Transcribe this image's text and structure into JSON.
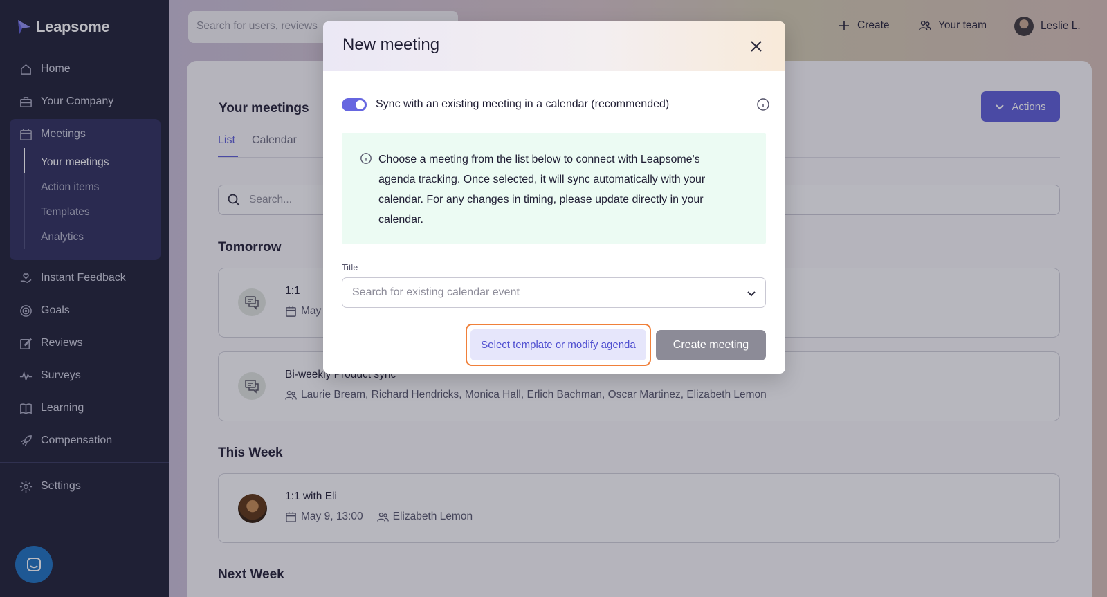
{
  "sidebar": {
    "brand": "Leapsome",
    "items": [
      {
        "label": "Home",
        "icon": "home-icon"
      },
      {
        "label": "Your Company",
        "icon": "briefcase-icon"
      },
      {
        "label": "Meetings",
        "icon": "calendar-chat-icon"
      },
      {
        "label": "Instant Feedback",
        "icon": "hand-heart-icon"
      },
      {
        "label": "Goals",
        "icon": "target-icon"
      },
      {
        "label": "Reviews",
        "icon": "edit-icon"
      },
      {
        "label": "Surveys",
        "icon": "pulse-icon"
      },
      {
        "label": "Learning",
        "icon": "book-icon"
      },
      {
        "label": "Compensation",
        "icon": "rocket-icon"
      },
      {
        "label": "Settings",
        "icon": "gear-icon"
      }
    ],
    "meetings_sub": [
      "Your meetings",
      "Action items",
      "Templates",
      "Analytics"
    ]
  },
  "topbar": {
    "search_placeholder": "Search for users, reviews",
    "create": "Create",
    "your_team": "Your team",
    "user": "Leslie L."
  },
  "page": {
    "title": "Your meetings",
    "tabs": [
      "List",
      "Calendar"
    ],
    "actions": "Actions",
    "search_placeholder": "Search...",
    "sections": {
      "tomorrow": "Tomorrow",
      "this_week": "This Week",
      "next_week": "Next Week"
    },
    "cards": [
      {
        "title": "1:1",
        "meta": "May"
      },
      {
        "title": "Bi-weekly Product sync",
        "meta": "Laurie Bream, Richard Hendricks, Monica Hall, Erlich Bachman, Oscar Martinez, Elizabeth Lemon"
      },
      {
        "title": "1:1 with Eli",
        "date": "May 9, 13:00",
        "attendee": "Elizabeth Lemon"
      }
    ]
  },
  "modal": {
    "title": "New meeting",
    "toggle_label": "Sync with an existing meeting in a calendar (recommended)",
    "notice": "Choose a meeting from the list below to connect with Leapsome's agenda tracking. Once selected, it will sync automatically with your calendar. For any changes in timing, please update directly in your calendar.",
    "field_label": "Title",
    "select_placeholder": "Search for existing calendar event",
    "template_button": "Select template or modify agenda",
    "create_button": "Create meeting"
  },
  "colors": {
    "accent": "#5b5bd6",
    "sidebar": "#1b1c33",
    "highlight_ring": "#f0803a"
  }
}
